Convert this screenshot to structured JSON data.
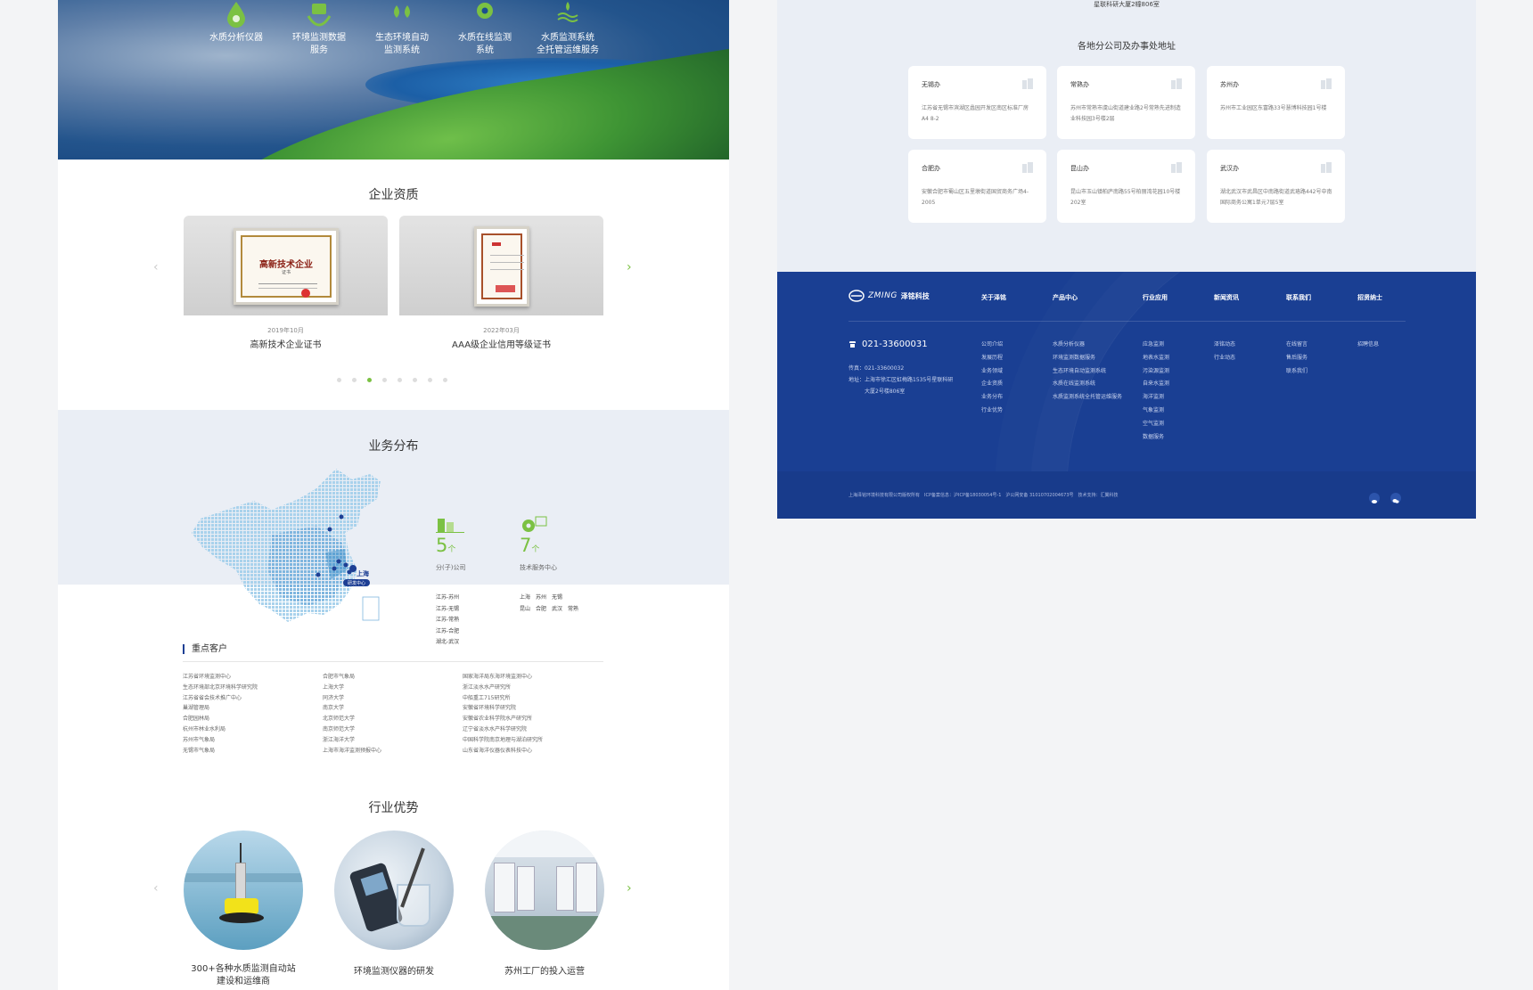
{
  "hero": {
    "items": [
      {
        "label1": "水质分析仪器",
        "label2": ""
      },
      {
        "label1": "环境监测数据",
        "label2": "服务"
      },
      {
        "label1": "生态环境自动",
        "label2": "监测系统"
      },
      {
        "label1": "水质在线监测",
        "label2": "系统"
      },
      {
        "label1": "水质监测系统",
        "label2": "全托管运维服务"
      }
    ]
  },
  "qualification": {
    "title": "企业资质",
    "certs": [
      {
        "date": "2019年10月",
        "name": "高新技术企业证书",
        "cert_title": "高新技术企业",
        "cert_sub": "证书"
      },
      {
        "date": "2022年03月",
        "name": "AAA级企业信用等级证书"
      }
    ],
    "prev_arrow": "‹",
    "next_arrow": "›",
    "dots_total": 8,
    "dots_active": 3
  },
  "business": {
    "title": "业务分布",
    "map_label": "上海",
    "map_badge": "研发中心",
    "stat1": {
      "value": "5",
      "unit": "个",
      "label": "分(子)公司"
    },
    "stat2": {
      "value": "7",
      "unit": "个",
      "label": "技术服务中心"
    },
    "branches": [
      "江苏-苏州",
      "江苏-无锡",
      "江苏-常熟",
      "江苏-合肥",
      "湖北-武汉"
    ],
    "service_row1": "上海　苏州　无锡",
    "service_row2": "昆山　合肥　武汉　常熟"
  },
  "clients": {
    "title": "重点客户",
    "col1": [
      "江苏省环境监测中心",
      "生态环境部北京环境科学研究院",
      "江苏省省会技术推广中心",
      "巢湖管理局",
      "合肥园林局",
      "杭州市林业水利局",
      "苏州市气象局",
      "无锡市气象局"
    ],
    "col2": [
      "合肥市气象局",
      "上海大学",
      "同济大学",
      "南京大学",
      "北京师范大学",
      "南京师范大学",
      "浙江海洋大学",
      "上海市海洋监测预报中心"
    ],
    "col3": [
      "国家海洋局东海环境监测中心",
      "浙江淡水水产研究所",
      "中船重工715研究所",
      "安徽省环境科学研究院",
      "安徽省农业科学院水产研究所",
      "辽宁省淡水水产科学研究院",
      "中国科学院南京地理与湖泊研究所",
      "山东省海洋仪器仪表科技中心"
    ]
  },
  "advantage": {
    "title": "行业优势",
    "items": [
      {
        "line1": "300+各种水质监测自动站",
        "line2": "建设和运维商"
      },
      {
        "line1": "环境监测仪器的研发",
        "line2": ""
      },
      {
        "line1": "苏州工厂的投入运营",
        "line2": ""
      }
    ],
    "prev_arrow": "‹",
    "next_arrow": "›"
  },
  "offices": {
    "top_address": "星联科研大厦2幢806室",
    "title": "各地分公司及办事处地址",
    "cards": [
      {
        "name": "无锡办",
        "addr": "江苏省无锡市滨湖区蠡园开发区南区标准厂房A4 8-2"
      },
      {
        "name": "常熟办",
        "addr": "苏州市常熟市虞山街道建业路2号常熟先进制造业科技园3号楼2层"
      },
      {
        "name": "苏州办",
        "addr": "苏州市工业园区东富路33号慧博科技园1号楼"
      },
      {
        "name": "合肥办",
        "addr": "安徽合肥市蜀山区五里墩街道国贸商务广场4-2005"
      },
      {
        "name": "昆山办",
        "addr": "昆山市玉山镇柏庐南路55号柏丽湾花园10号楼202室"
      },
      {
        "name": "武汉办",
        "addr": "湖北武汉市武昌区中南路街道武珞路442号中南国际商务公寓1单元7层5室"
      }
    ]
  },
  "footer": {
    "logo_en": "ZMING",
    "logo_cn": "泽铭科技",
    "phone": "021-33600031",
    "fax": "传真：021-33600032",
    "address1": "地址：上海市徐汇区虹梅路1535号星联科研",
    "address2": "大厦2号楼806室",
    "columns": [
      {
        "title": "关于泽铭",
        "links": [
          "公司介绍",
          "发展历程",
          "业务领域",
          "企业资质",
          "业务分布",
          "行业优势"
        ]
      },
      {
        "title": "产品中心",
        "links": [
          "水质分析仪器",
          "环境监测数据服务",
          "生态环境自动监测系统",
          "水质在线监测系统",
          "水质监测系统全托管运维服务"
        ]
      },
      {
        "title": "行业应用",
        "links": [
          "应急监测",
          "地表水监测",
          "污染源监测",
          "自来水监测",
          "海洋监测",
          "气象监测",
          "空气监测",
          "数据服务"
        ]
      },
      {
        "title": "新闻资讯",
        "links": [
          "泽铭动态",
          "行业动态"
        ]
      },
      {
        "title": "联系我们",
        "links": [
          "在线留言",
          "售后服务",
          "联系我们"
        ]
      },
      {
        "title": "招贤纳士",
        "links": [
          "招聘信息"
        ]
      }
    ],
    "bottom_text": "上海泽铭环境科技有限公司版权所有　ICP备案信息：沪ICP备18030054号-1　沪公网安备 31010702004673号　技术支持：汇翼科技",
    "social": [
      "weibo-icon",
      "wechat-icon"
    ]
  },
  "colors": {
    "primary": "#1a3f93",
    "accent": "#7bc143",
    "light_bg": "#eaeef5"
  }
}
